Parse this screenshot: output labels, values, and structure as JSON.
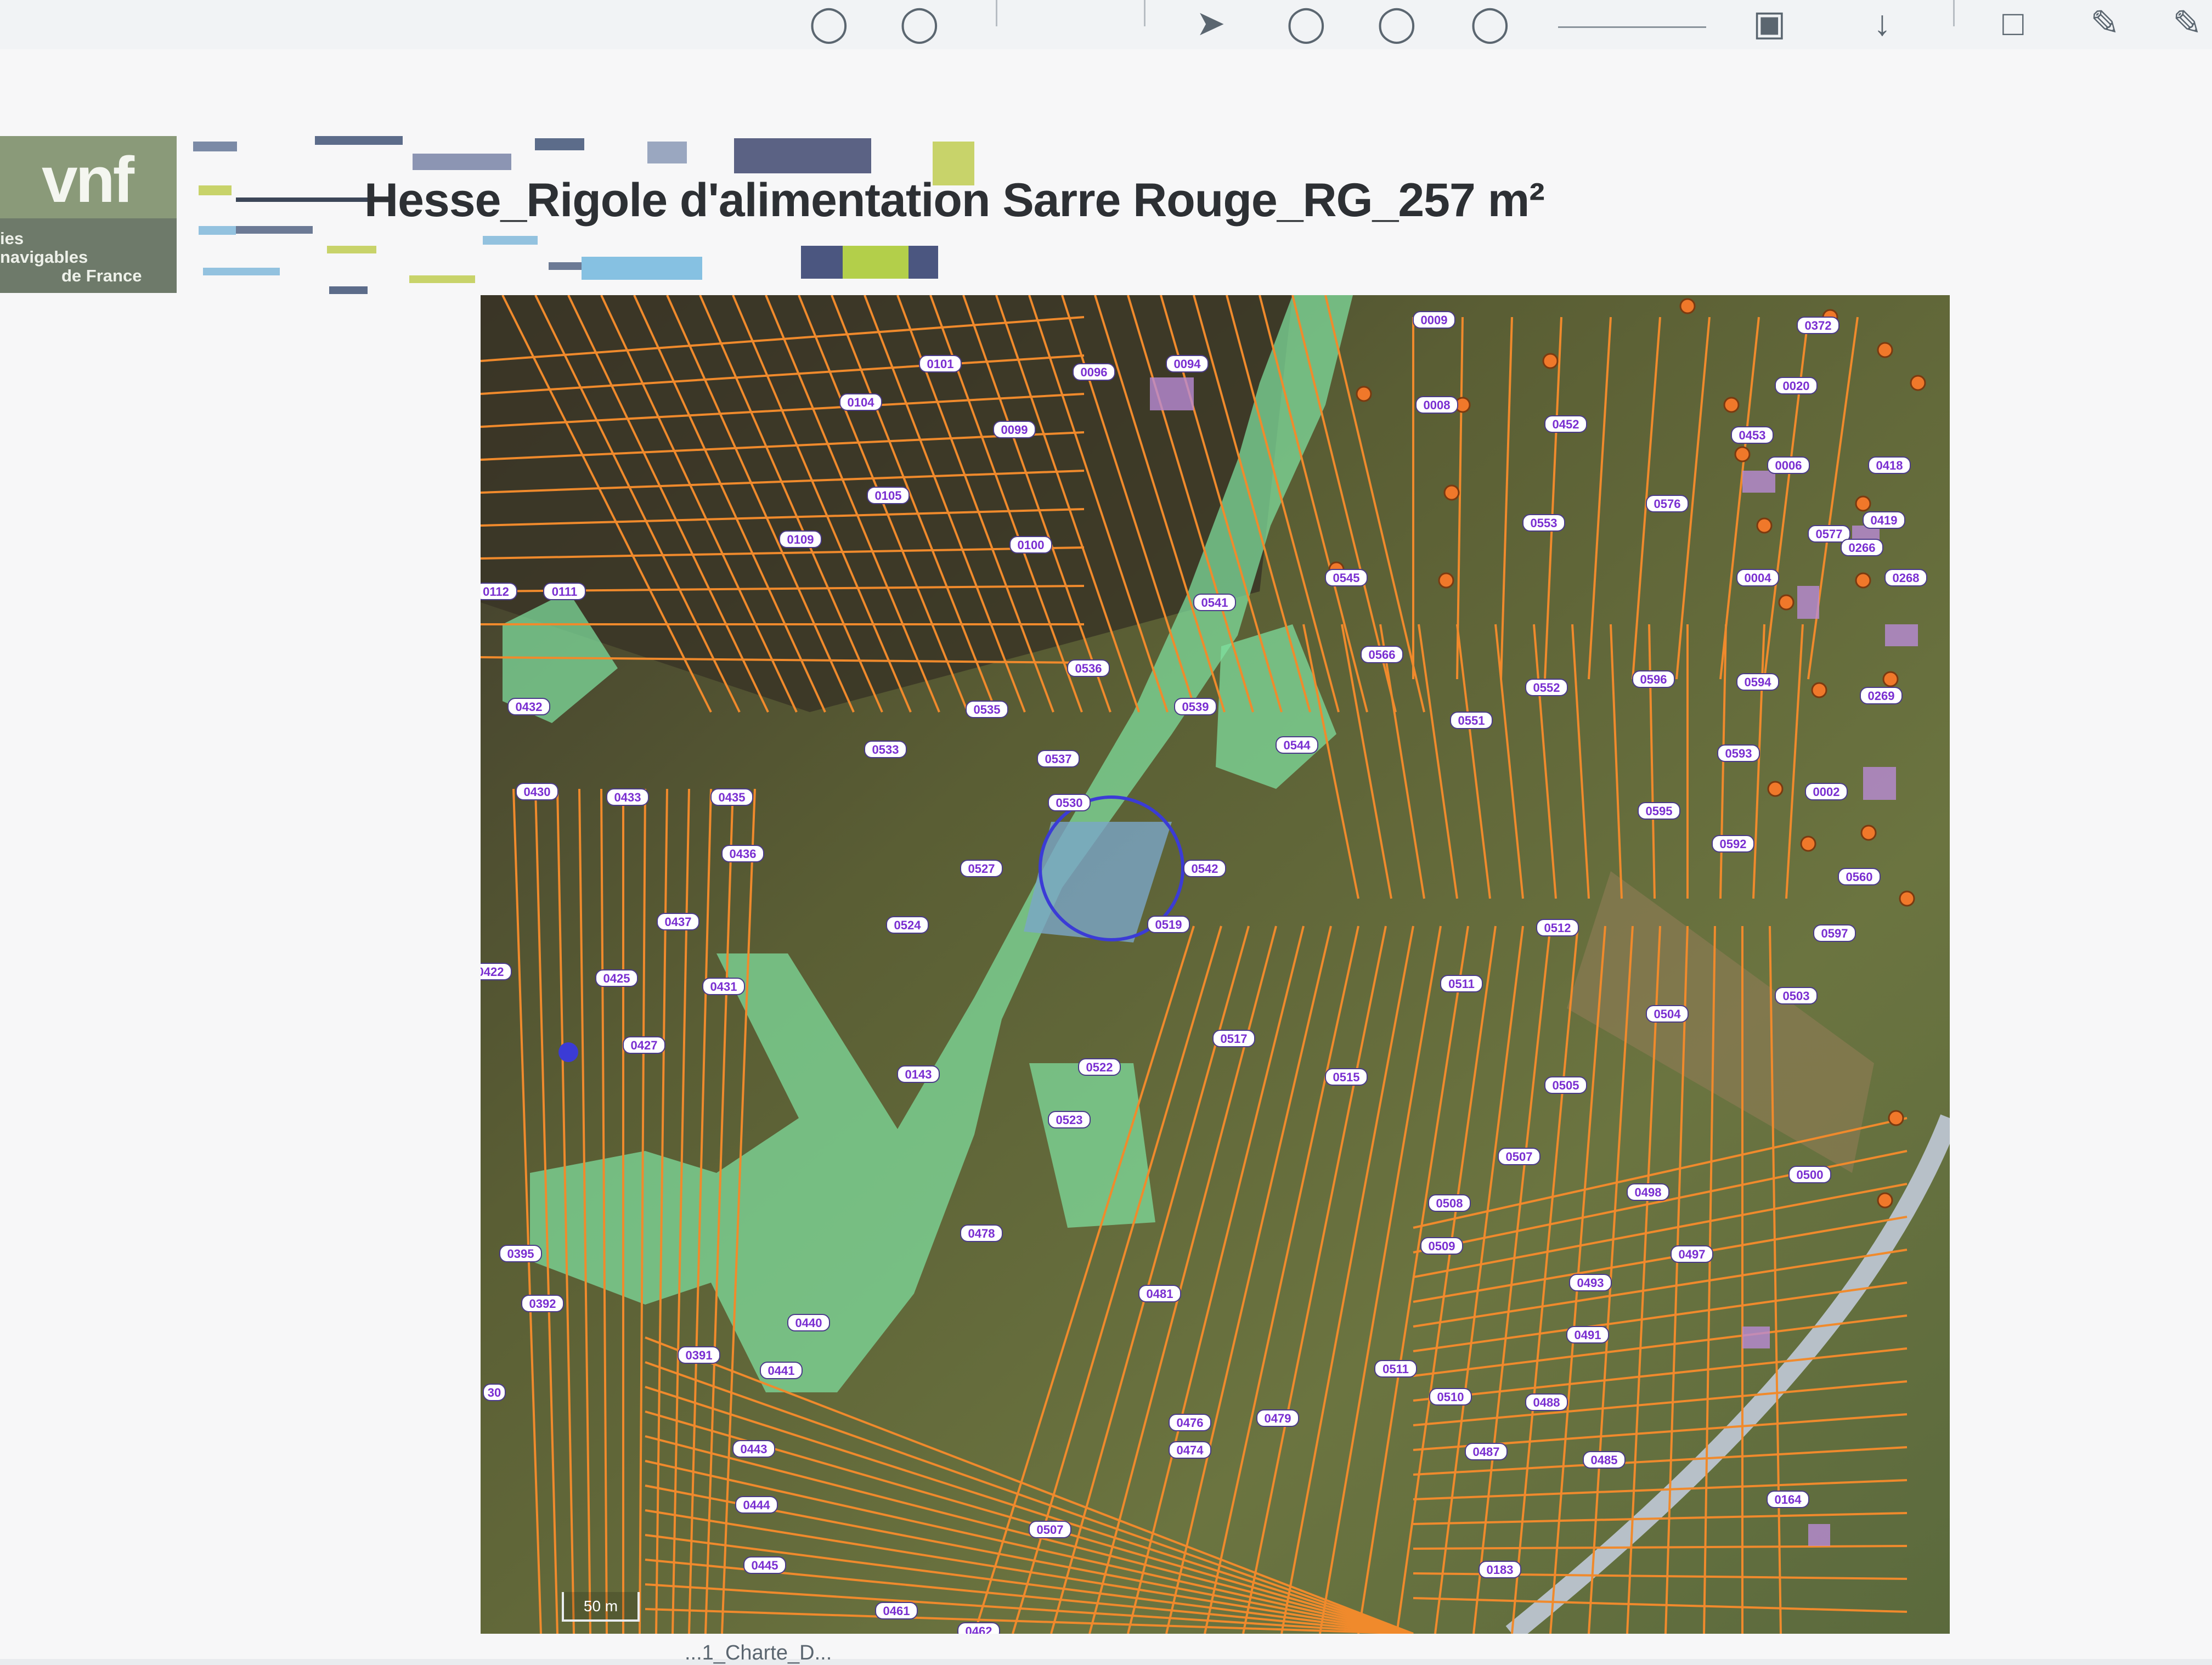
{
  "viewer": {
    "zoom_value": "",
    "icons": [
      "pan-icon",
      "zoom-out-icon",
      "zoom-in-icon",
      "page-icon",
      "cursor-icon",
      "circle-icon",
      "circle-icon",
      "arrow-up-icon",
      "download-icon",
      "comment-icon",
      "pen-icon",
      "sign-icon"
    ]
  },
  "document": {
    "title": "Hesse_Rigole d'alimentation Sarre Rouge_RG_257 m²",
    "logo": {
      "mark": "vnf",
      "line1": "ies",
      "line2": "navigables",
      "line3": "de France"
    }
  },
  "map": {
    "scale_label": "50 m",
    "colors": {
      "parcel_lines": "#f08a2c",
      "parcel_label_bg": "#ffffff",
      "parcel_label_text": "#7a2fd1",
      "highlight_zone": "#7fe0a0",
      "selection_circle": "#3b3bd6",
      "boundary_points": "#f0782a"
    },
    "parcels": [
      "0009",
      "0372",
      "0094",
      "0096",
      "0101",
      "0104",
      "0099",
      "0008",
      "0452",
      "0020",
      "0453",
      "0105",
      "0109",
      "0100",
      "0553",
      "0576",
      "0006",
      "0418",
      "0111",
      "0112",
      "0545",
      "0541",
      "0577",
      "0419",
      "0266",
      "0004",
      "0268",
      "0566",
      "0536",
      "0539",
      "0535",
      "0552",
      "0596",
      "0551",
      "0594",
      "0269",
      "0432",
      "0533",
      "0537",
      "0544",
      "0593",
      "0430",
      "0433",
      "0435",
      "0530",
      "0595",
      "0002",
      "0436",
      "0527",
      "0542",
      "0592",
      "0560",
      "0437",
      "0524",
      "0519",
      "0512",
      "0597",
      "0422",
      "0425",
      "0431",
      "0511",
      "0504",
      "0503",
      "0427",
      "0517",
      "0522",
      "0143",
      "0515",
      "0505",
      "0523",
      "0507",
      "0500",
      "0508",
      "0498",
      "0478",
      "0509",
      "0497",
      "0395",
      "0481",
      "0493",
      "0392",
      "0440",
      "0491",
      "0391",
      "0441",
      "0511",
      "0510",
      "0488",
      "0476",
      "0479",
      "0487",
      "0443",
      "0474",
      "0485",
      "0444",
      "0164",
      "0507",
      "0445",
      "0183",
      "0461",
      "0462",
      "30"
    ]
  },
  "caption": "...1_Charte_D..."
}
